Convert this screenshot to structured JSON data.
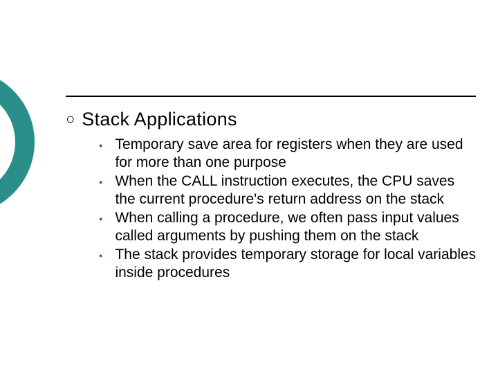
{
  "heading": "Stack Applications",
  "bullets": [
    "Temporary save area for registers when they are used for more than one purpose",
    "When the CALL instruction executes, the CPU saves the current procedure's return address on the stack",
    "When calling a procedure, we often pass input values called arguments by pushing them on the stack",
    "The stack provides temporary storage for local variables inside procedures"
  ]
}
